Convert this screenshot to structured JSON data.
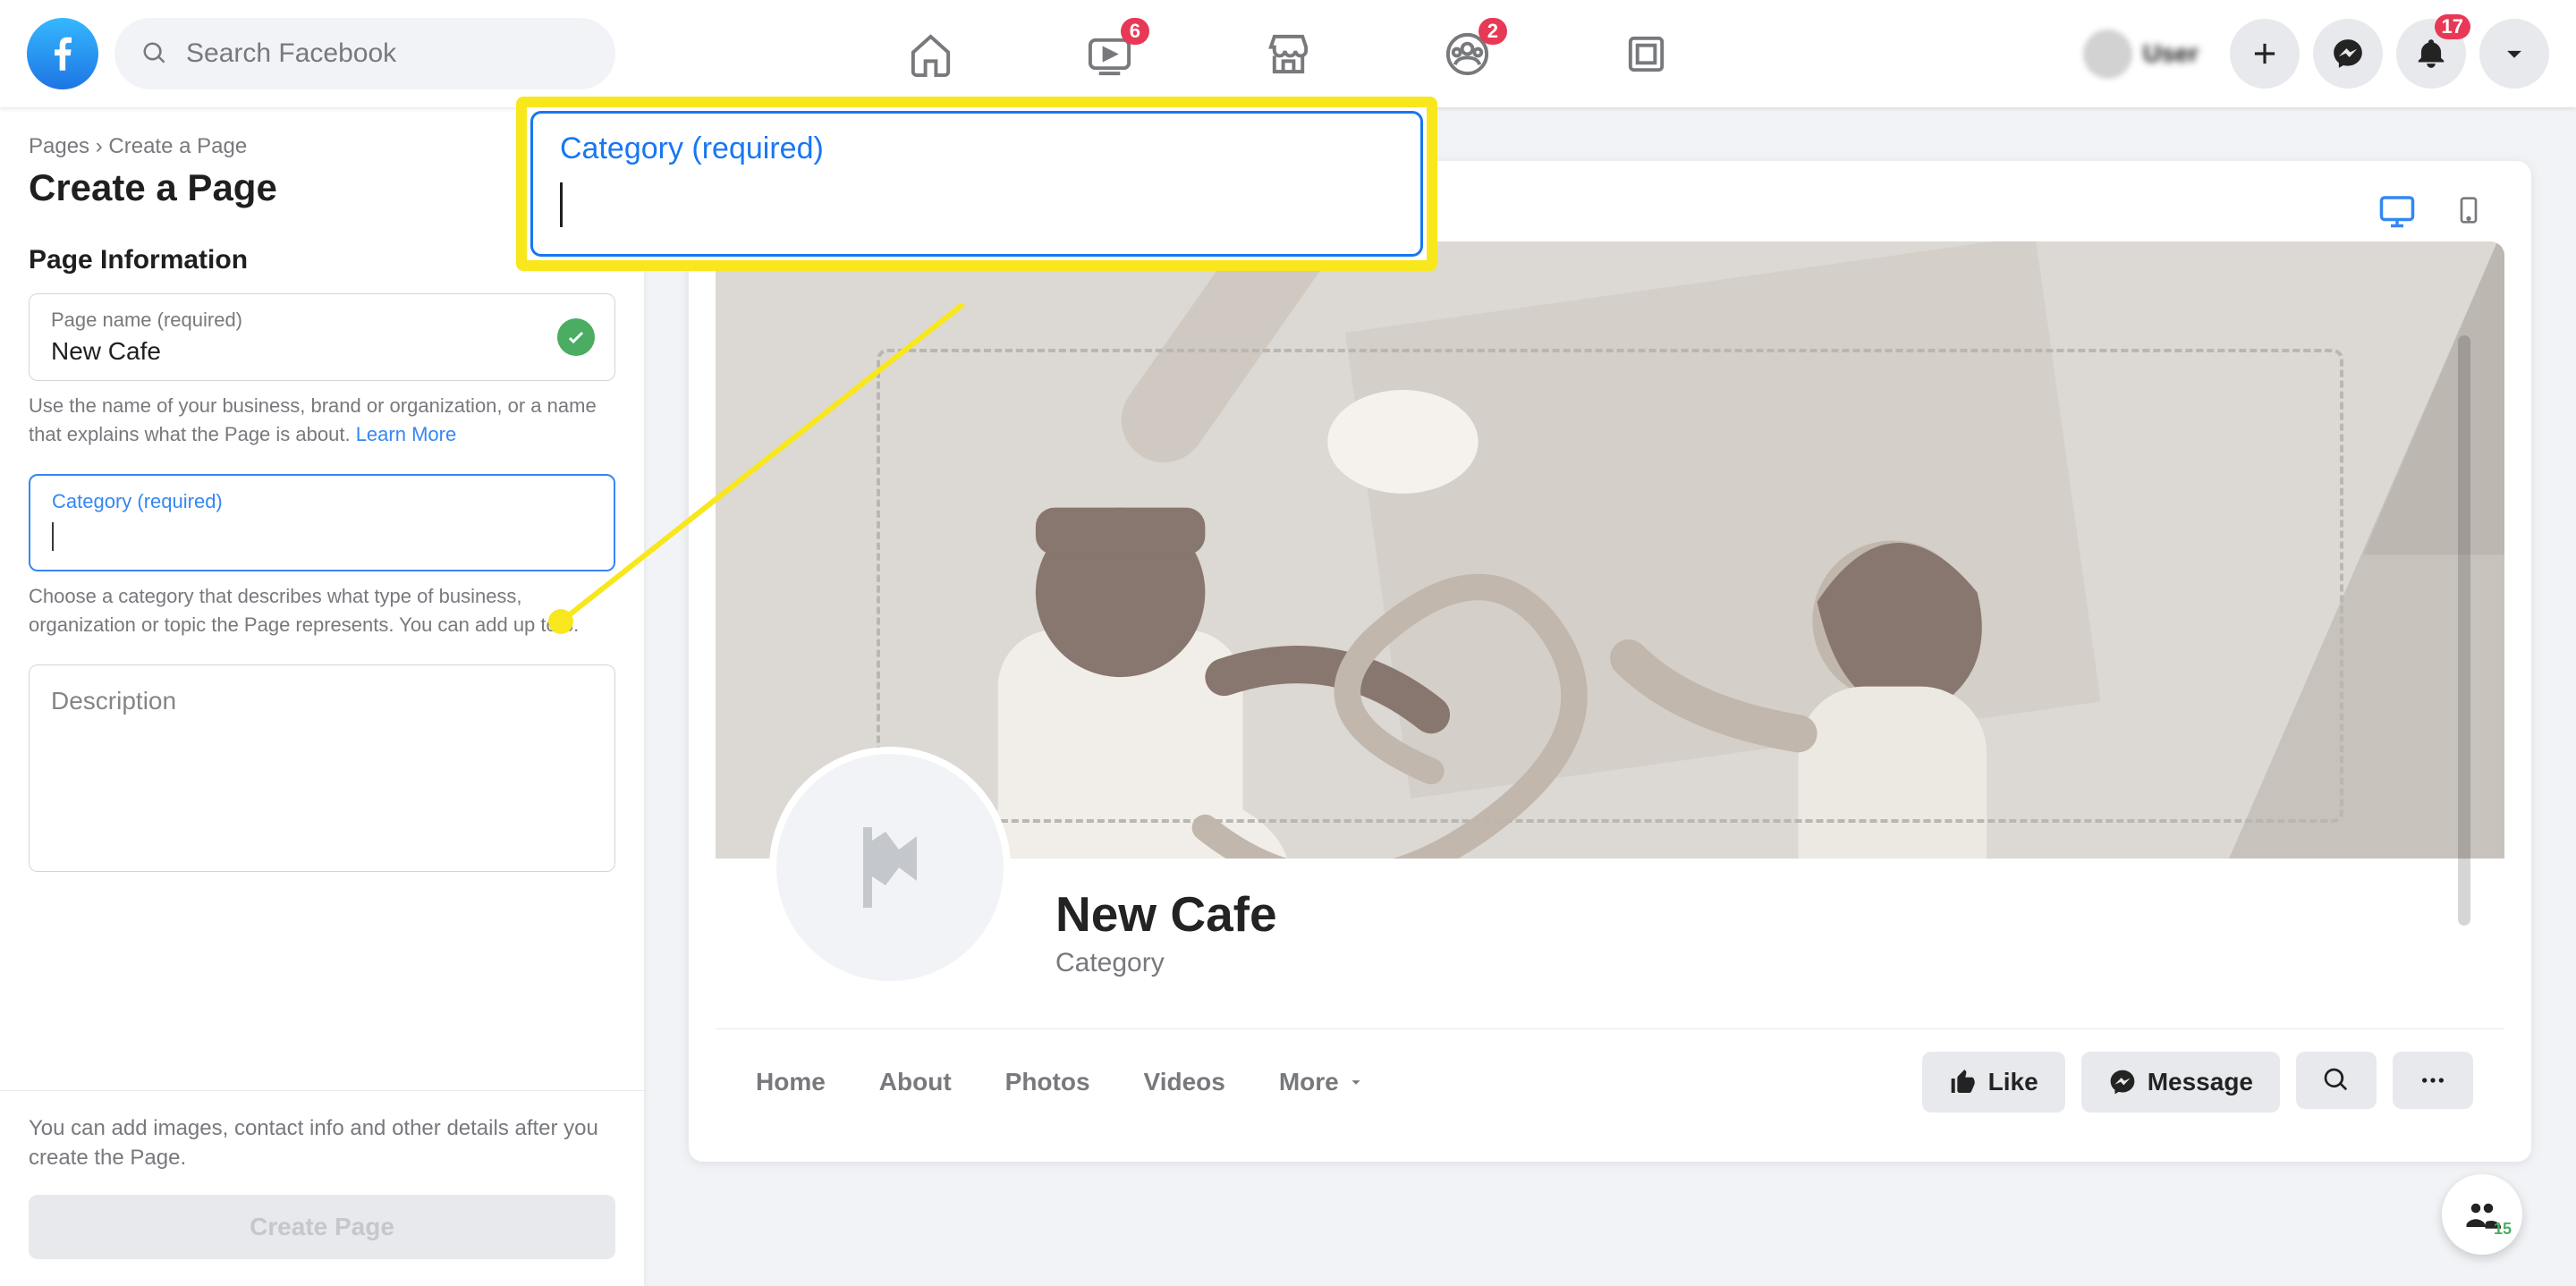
{
  "header": {
    "search_placeholder": "Search Facebook",
    "badges": {
      "watch": "6",
      "groups": "2",
      "notifications": "17"
    },
    "profile_name": "User"
  },
  "sidebar": {
    "breadcrumb_pages": "Pages",
    "breadcrumb_sep": " › ",
    "breadcrumb_create": "Create a Page",
    "title": "Create a Page",
    "section": "Page Information",
    "page_name_label": "Page name (required)",
    "page_name_value": "New Cafe",
    "page_name_help": "Use the name of your business, brand or organization, or a name that explains what the Page is about. ",
    "learn_more": "Learn More",
    "category_label": "Category (required)",
    "category_help": "Choose a category that describes what type of business, organization or topic the Page represents. You can add up to 3.",
    "description_placeholder": "Description",
    "footer_text": "You can add images, contact info and other details after you create the Page.",
    "create_button": "Create Page"
  },
  "preview": {
    "page_name": "New Cafe",
    "page_category": "Category",
    "tabs": [
      "Home",
      "About",
      "Photos",
      "Videos"
    ],
    "more": "More",
    "like": "Like",
    "message": "Message",
    "float_count": "15"
  },
  "callout": {
    "label": "Category (required)"
  }
}
